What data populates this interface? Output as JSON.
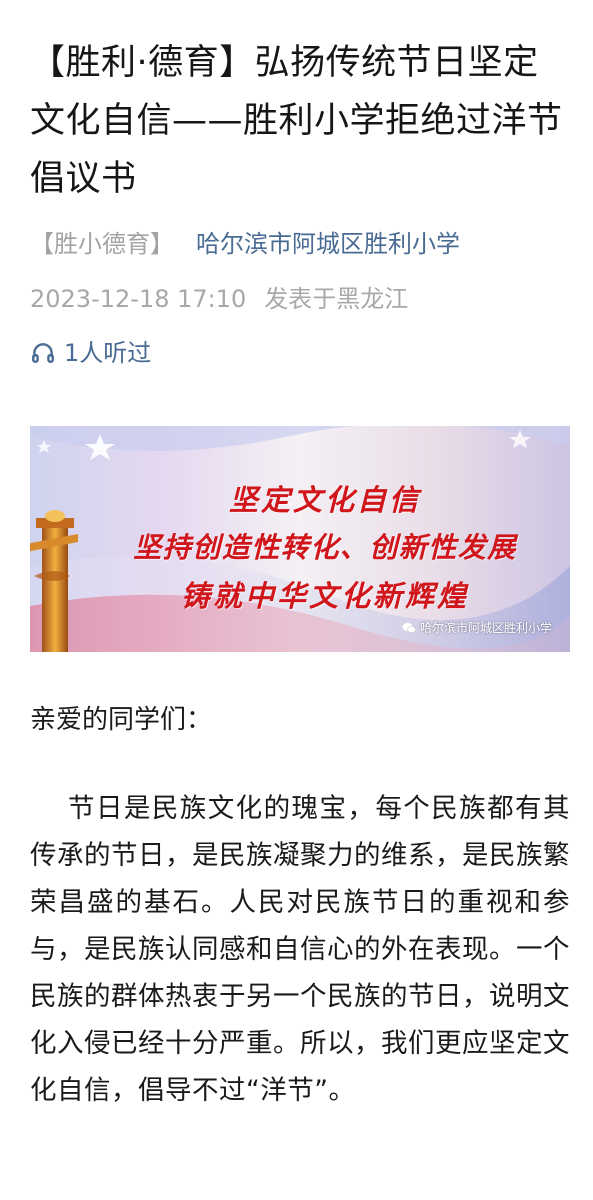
{
  "article": {
    "title": "【胜利·德育】弘扬传统节日坚定文化自信——胜利小学拒绝过洋节倡议书",
    "tag": "【胜小德育】",
    "account": "哈尔滨市阿城区胜利小学",
    "datetime": "2023-12-18 17:10",
    "location": "发表于黑龙江",
    "listen_count": "1人听过"
  },
  "banner": {
    "lines": [
      "坚定文化自信",
      "坚持创造性转化、创新性发展",
      "铸就中华文化新辉煌"
    ],
    "watermark": "哈尔滨市阿城区胜利小学"
  },
  "content": {
    "greeting": "亲爱的同学们：",
    "paragraph_1": "节日是民族文化的瑰宝，每个民族都有其传承的节日，是民族凝聚力的维系，是民族繁荣昌盛的基石。人民对民族节日的重视和参与，是民族认同感和自信心的外在表现。一个民族的群体热衷于另一个民族的节日，说明文化入侵已经十分严重。所以，我们更应坚定文化自信，倡导不过“洋节”。"
  },
  "icons": {
    "listen": "headphones-icon",
    "watermark": "wechat-icon"
  },
  "colors": {
    "link": "#4a6b93",
    "muted": "#a8a8a8",
    "banner_text": "#d0161b"
  }
}
